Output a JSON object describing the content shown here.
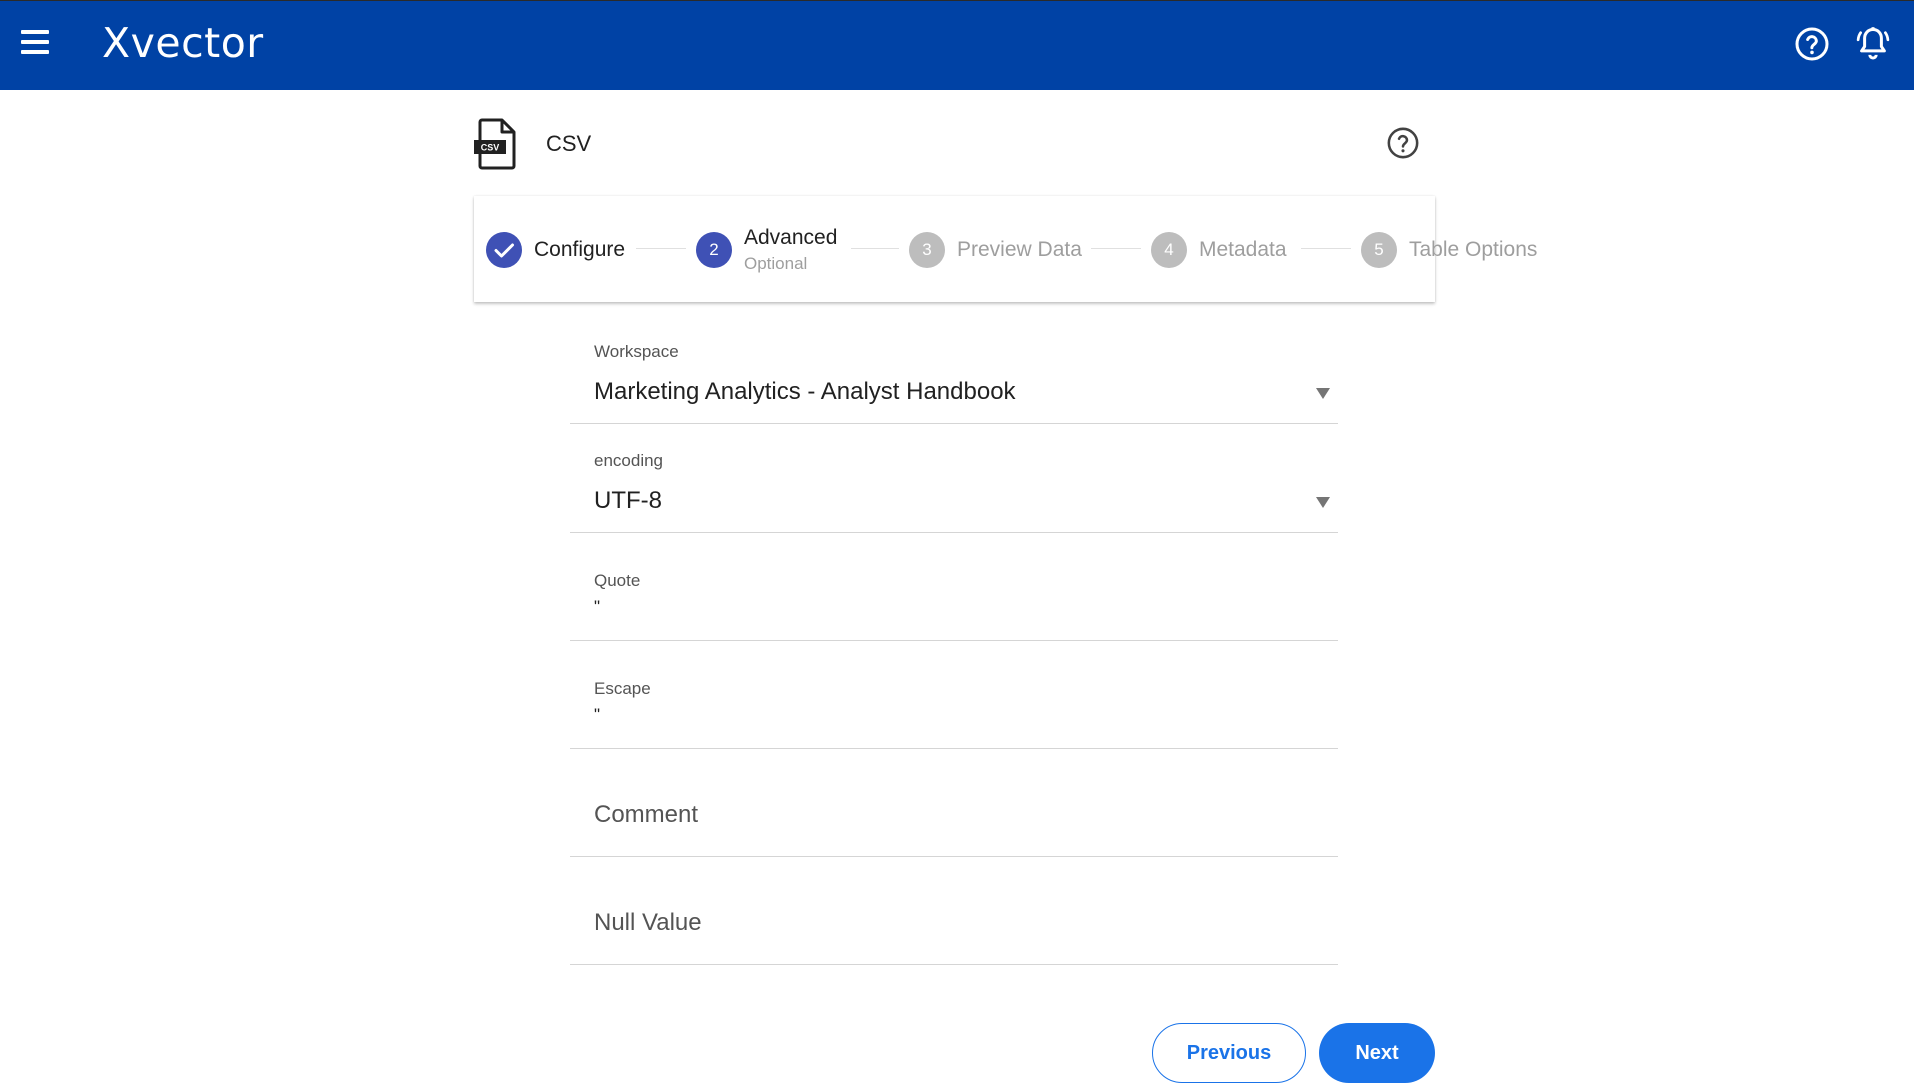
{
  "app": {
    "logo_text": "Xvector",
    "brand_color": "#0042a5"
  },
  "header": {
    "menu_icon": "hamburger-menu-icon",
    "help_icon": "help-circle-icon",
    "notification_icon": "bell-icon"
  },
  "file": {
    "icon": "csv-file-icon",
    "badge": "CSV",
    "title": "CSV",
    "help_icon": "help-circle-icon"
  },
  "stepper": {
    "steps": [
      {
        "number": "1",
        "label": "Configure",
        "state": "completed"
      },
      {
        "number": "2",
        "label": "Advanced",
        "sublabel": "Optional",
        "state": "active"
      },
      {
        "number": "3",
        "label": "Preview Data",
        "state": "pending"
      },
      {
        "number": "4",
        "label": "Metadata",
        "state": "pending"
      },
      {
        "number": "5",
        "label": "Table Options",
        "state": "pending"
      }
    ],
    "active_color": "#3f51b5"
  },
  "form": {
    "workspace": {
      "label": "Workspace",
      "value": "Marketing Analytics - Analyst Handbook"
    },
    "encoding": {
      "label": "encoding",
      "value": "UTF-8"
    },
    "quote": {
      "label": "Quote",
      "value": "\""
    },
    "escape": {
      "label": "Escape",
      "value": "\""
    },
    "comment": {
      "placeholder": "Comment"
    },
    "null_value": {
      "placeholder": "Null Value"
    }
  },
  "actions": {
    "previous_label": "Previous",
    "next_label": "Next",
    "button_color": "#1a73e8"
  }
}
